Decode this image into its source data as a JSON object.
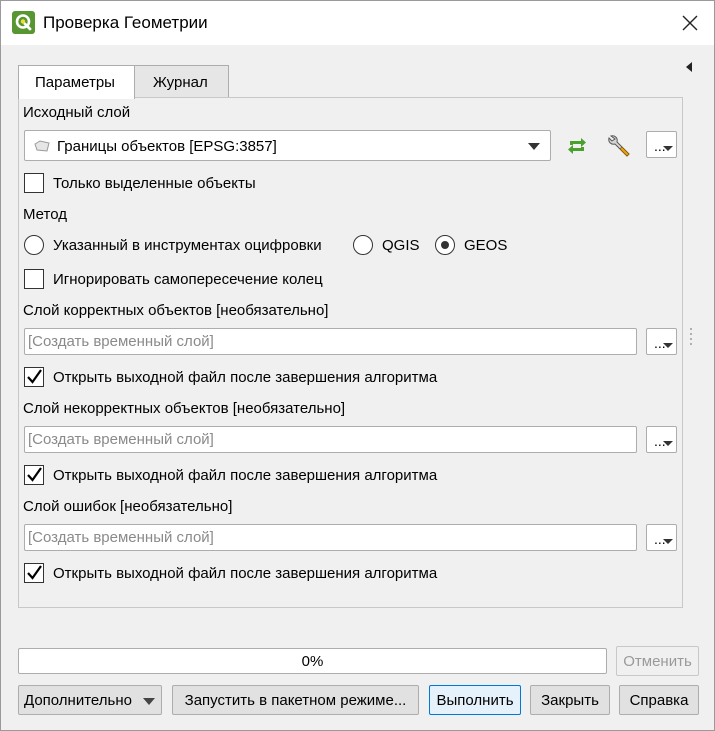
{
  "window": {
    "title": "Проверка Геометрии"
  },
  "tabs": [
    {
      "label": "Параметры",
      "active": true
    },
    {
      "label": "Журнал",
      "active": false
    }
  ],
  "params": {
    "input_layer_label": "Исходный слой",
    "input_layer_value": "Границы объектов [EPSG:3857]",
    "selected_only_label": "Только выделенные объекты",
    "selected_only_checked": false,
    "method_label": "Метод",
    "method_options": [
      {
        "label": "Указанный в инструментах оцифровки",
        "selected": false
      },
      {
        "label": "QGIS",
        "selected": false
      },
      {
        "label": "GEOS",
        "selected": true
      }
    ],
    "ignore_ring_label": "Игнорировать самопересечение колец",
    "ignore_ring_checked": false,
    "outputs": [
      {
        "label": "Слой корректных объектов [необязательно]",
        "placeholder": "[Создать временный слой]",
        "open_label": "Открыть выходной файл после завершения алгоритма",
        "open_checked": true
      },
      {
        "label": "Слой некорректных объектов [необязательно]",
        "placeholder": "[Создать временный слой]",
        "open_label": "Открыть выходной файл после завершения алгоритма",
        "open_checked": true
      },
      {
        "label": "Слой ошибок [необязательно]",
        "placeholder": "[Создать временный слой]",
        "open_label": "Открыть выходной файл после завершения алгоритма",
        "open_checked": true
      }
    ],
    "dots_label": "..."
  },
  "footer": {
    "progress_text": "0%",
    "progress_value": 0,
    "cancel_label": "Отменить",
    "advanced_label": "Дополнительно",
    "batch_label": "Запустить в пакетном режиме...",
    "run_label": "Выполнить",
    "close_label": "Закрыть",
    "help_label": "Справка"
  },
  "colors": {
    "accent": "#0078d7",
    "qgis_icon": "#589632",
    "refresh_icon": "#4aa02c"
  }
}
